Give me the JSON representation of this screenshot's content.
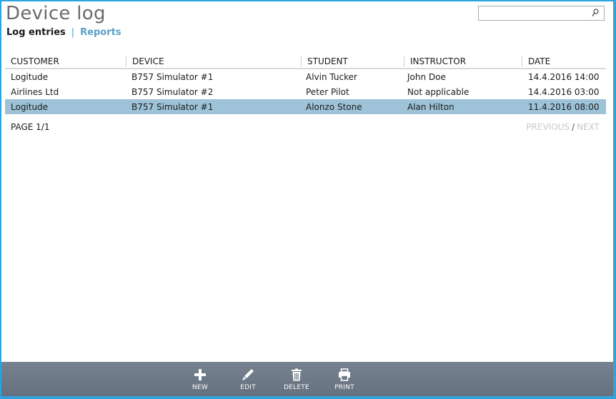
{
  "app": {
    "title": "Device log"
  },
  "search": {
    "value": "",
    "placeholder": ""
  },
  "tabs": [
    {
      "label": "Log entries",
      "active": true
    },
    {
      "label": "Reports",
      "active": false
    }
  ],
  "table": {
    "columns": [
      "CUSTOMER",
      "DEVICE",
      "STUDENT",
      "INSTRUCTOR",
      "DATE"
    ],
    "rows": [
      {
        "customer": "Logitude",
        "device": "B757 Simulator #1",
        "student": "Alvin Tucker",
        "instructor": "John Doe",
        "date": "14.4.2016 14:00",
        "selected": false
      },
      {
        "customer": "Airlines Ltd",
        "device": "B757 Simulator #2",
        "student": "Peter Pilot",
        "instructor": "Not applicable",
        "date": "14.4.2016 03:00",
        "selected": false
      },
      {
        "customer": "Logitude",
        "device": "B757 Simulator #1",
        "student": "Alonzo Stone",
        "instructor": "Alan Hilton",
        "date": "11.4.2016 08:00",
        "selected": true
      }
    ]
  },
  "pager": {
    "label": "PAGE 1/1",
    "previous": "PREVIOUS",
    "separator": "/",
    "next": "NEXT"
  },
  "toolbar": {
    "new": "NEW",
    "edit": "EDIT",
    "delete": "DELETE",
    "print": "PRINT",
    "icons": {
      "new": "plus-icon",
      "edit": "pencil-icon",
      "delete": "trash-icon",
      "print": "printer-icon"
    }
  },
  "colors": {
    "frame": "#2fa3e0",
    "selected_row": "#9ec3d8",
    "tab_link": "#5a9fc8",
    "toolbar": "#6d7986"
  }
}
